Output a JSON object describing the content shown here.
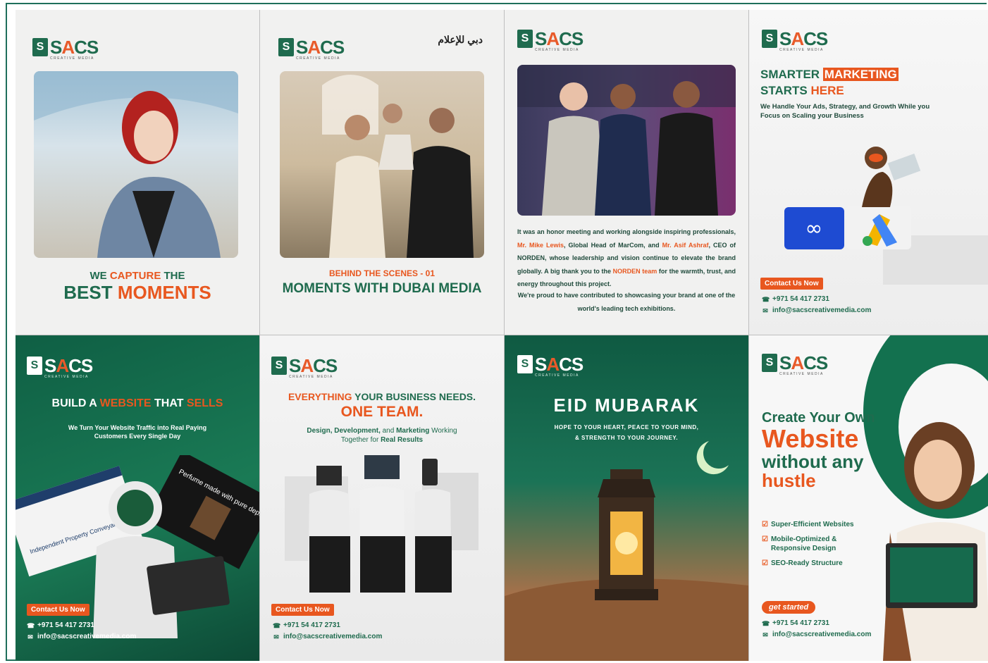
{
  "brand": {
    "word_a": "S",
    "word_b": "A",
    "word_c": "CS",
    "sub": "CREATIVE MEDIA",
    "mark": "S"
  },
  "post1": {
    "line1_a": "WE ",
    "line1_b": "CAPTURE",
    "line1_c": " THE",
    "line2_a": "BEST ",
    "line2_b": "MOMENTS"
  },
  "post2": {
    "kicker": "BEHIND THE SCENES - 01",
    "title": "MOMENTS WITH DUBAI MEDIA",
    "partner_logo": "دبي للإعلام"
  },
  "post3": {
    "p1_a": "It was an honor meeting and working alongside inspiring professionals, ",
    "p1_b": "Mr. Mike Lewis",
    "p1_c": ", Global Head of MarCom, and ",
    "p1_d": "Mr. Asif Ashraf",
    "p1_e": ", CEO of NORDEN, whose leadership and vision continue to elevate the brand globally. A big thank you to the ",
    "p1_f": "NORDEN team",
    "p1_g": " for the warmth, trust, and energy throughout this project.",
    "p2": "We're proud to have contributed to showcasing your brand at one of the world's leading tech exhibitions."
  },
  "post4": {
    "h1": "SMARTER ",
    "h1_hl": "MARKETING",
    "h2_a": "STARTS ",
    "h2_b": "HERE",
    "sub": "We Handle Your Ads, Strategy, and Growth While you Focus on Scaling your Business",
    "cta": "Contact Us Now",
    "phone": "+971 54 417 2731",
    "email": "info@sacscreativemedia.com"
  },
  "post5": {
    "h_a": "BUILD A ",
    "h_b": "WEBSITE",
    "h_c": " THAT ",
    "h_d": "SELLS",
    "sub": "We Turn Your Website Traffic into Real Paying Customers Every Single Day",
    "screen_text": "Independent Property Conveyancing - Dubai",
    "screen_text2": "Perfume made with pure depth",
    "cta": "Contact Us Now",
    "phone": "+971 54 417 2731",
    "email": "info@sacscreativemedia.com"
  },
  "post6": {
    "h_a": "EVERYTHING",
    "h_b": " YOUR BUSINESS NEEDS.",
    "h2": "ONE TEAM.",
    "sub_a": "Design, Development,",
    "sub_b": " and ",
    "sub_c": "Marketing",
    "sub_d": " Working",
    "sub2_a": "Together for ",
    "sub2_b": "Real Results",
    "cta": "Contact Us Now",
    "phone": "+971 54 417 2731",
    "email": "info@sacscreativemedia.com"
  },
  "post7": {
    "title": "EID MUBARAK",
    "sub1": "HOPE TO YOUR HEART, PEACE TO YOUR MIND,",
    "sub2": "& STRENGTH TO YOUR JOURNEY."
  },
  "post8": {
    "l1": "Create Your Own",
    "l2": "Website",
    "l3": "without any",
    "l4": "hustle",
    "features": [
      "Super-Efficient Websites",
      "Mobile-Optimized & Responsive Design",
      "SEO-Ready Structure"
    ],
    "cta": "get started",
    "phone": "+971 54 417 2731",
    "email": "info@sacscreativemedia.com"
  },
  "colors": {
    "brand_green": "#1f6b4e",
    "brand_orange": "#e8571f"
  }
}
